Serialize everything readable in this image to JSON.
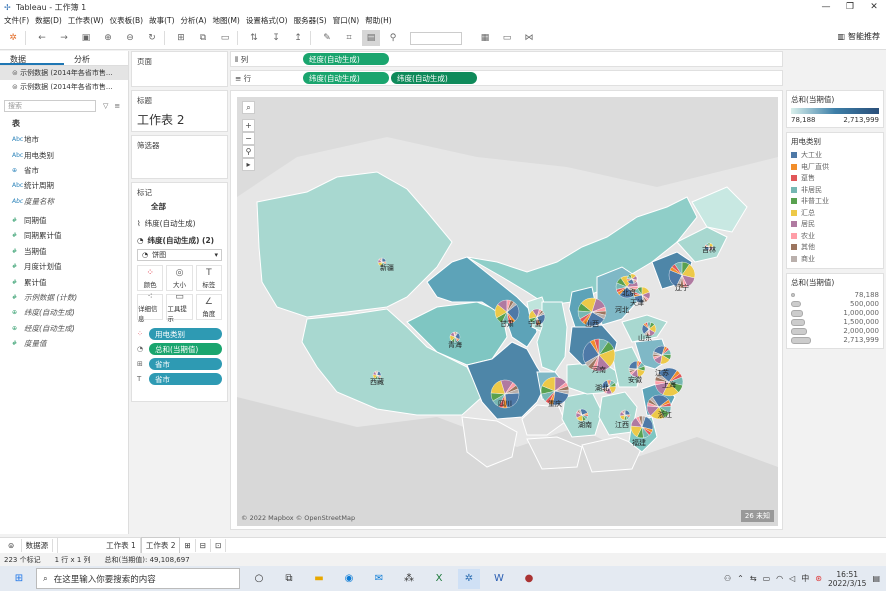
{
  "window": {
    "title": "Tableau - 工作簿 1",
    "controls": [
      "—",
      "❐",
      "✕"
    ]
  },
  "menu": [
    "文件(F)",
    "数据(D)",
    "工作表(W)",
    "仪表板(B)",
    "故事(T)",
    "分析(A)",
    "地图(M)",
    "设置格式(O)",
    "服务器(S)",
    "窗口(N)",
    "帮助(H)"
  ],
  "toolbar": {
    "smart_recommend": "智能推荐"
  },
  "data_pane": {
    "tabs": [
      "数据",
      "分析"
    ],
    "sources": [
      "示例数据 (2014年各省市售...",
      "示例数据 (2014年各省市售..."
    ],
    "search_placeholder": "搜索",
    "table_header": "表",
    "dimensions": [
      "地市",
      "用电类别",
      "省市",
      "统计周期",
      "度量名称"
    ],
    "measures": [
      "同期值",
      "同期累计值",
      "当期值",
      "月度计划值",
      "累计值",
      "示例数据 (计数)",
      "纬度(自动生成)",
      "经度(自动生成)",
      "度量值"
    ]
  },
  "cards": {
    "pages": "页面",
    "title_label": "标题",
    "sheet_title": "工作表 2",
    "filters": "筛选器",
    "marks": "标记",
    "marks_all": "全部",
    "marks_lat1": "纬度(自动生成)",
    "marks_lat2": "纬度(自动生成) (2)",
    "mark_type": "饼图",
    "mark_buttons": [
      "颜色",
      "大小",
      "标签",
      "详细信息",
      "工具提示",
      "角度"
    ],
    "mark_pills": [
      {
        "label": "用电类别",
        "kind": "teal"
      },
      {
        "label": "总和(当期值)",
        "kind": "green"
      },
      {
        "label": "省市",
        "kind": "teal"
      },
      {
        "label": "省市",
        "kind": "teal"
      }
    ]
  },
  "shelves": {
    "columns_label": "列",
    "rows_label": "行",
    "columns_pills": [
      "经度(自动生成)"
    ],
    "rows_pills": [
      "纬度(自动生成)",
      "纬度(自动生成)"
    ]
  },
  "map": {
    "attribution": "© 2022 Mapbox © OpenStreetMap",
    "unknown_badge": "26 未知",
    "labels": [
      "新疆",
      "西藏",
      "青海",
      "甘肃",
      "宁夏",
      "四川",
      "重庆",
      "山西",
      "河北",
      "北京",
      "天津",
      "吉林",
      "辽宁",
      "山东",
      "河南",
      "湖北",
      "安徽",
      "江苏",
      "上海",
      "浙江",
      "湖南",
      "江西",
      "福建"
    ]
  },
  "legends": {
    "gradient": {
      "title": "总和(当期值)",
      "min": "78,188",
      "max": "2,713,999"
    },
    "category": {
      "title": "用电类别",
      "items": [
        {
          "label": "大工业",
          "color": "#4e79a7"
        },
        {
          "label": "电厂直供",
          "color": "#f28e2b"
        },
        {
          "label": "趸售",
          "color": "#e15759"
        },
        {
          "label": "非居民",
          "color": "#76b7b2"
        },
        {
          "label": "非普工业",
          "color": "#59a14f"
        },
        {
          "label": "汇总",
          "color": "#edc948"
        },
        {
          "label": "居民",
          "color": "#b07aa1"
        },
        {
          "label": "农业",
          "color": "#ff9da7"
        },
        {
          "label": "其他",
          "color": "#9c755f"
        },
        {
          "label": "商业",
          "color": "#bab0ac"
        }
      ]
    },
    "size": {
      "title": "总和(当期值)",
      "items": [
        "78,188",
        "500,000",
        "1,000,000",
        "1,500,000",
        "2,000,000",
        "2,713,999"
      ]
    }
  },
  "sheet_tabs": [
    "数据源",
    "工作表 1",
    "工作表 2"
  ],
  "status": {
    "marks": "223 个标记",
    "rows_cols": "1 行 x 1 列",
    "sum": "总和(当期值): 49,108,697"
  },
  "taskbar": {
    "search_placeholder": "在这里输入你要搜索的内容",
    "time": "16:51",
    "date": "2022/3/15",
    "ime": "中"
  }
}
